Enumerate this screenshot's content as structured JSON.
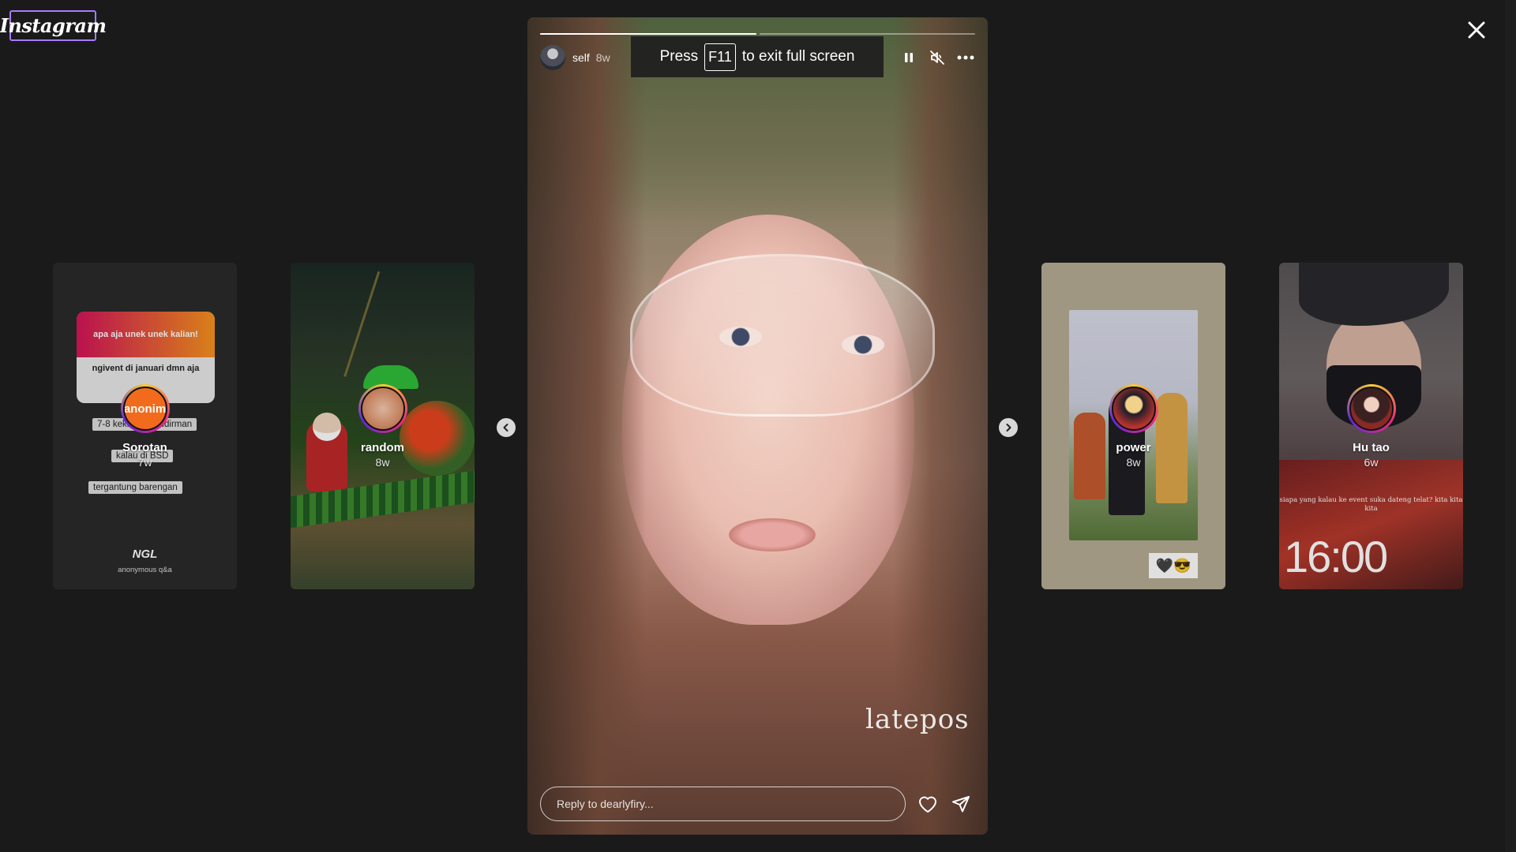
{
  "app": {
    "logo": "Instagram"
  },
  "colors": {
    "background": "#1a1a1a",
    "logo_border": "#a77bff",
    "ring_gradient": [
      "#f9ce34",
      "#ee2a7b",
      "#6228d7"
    ]
  },
  "icons": {
    "close": "close-icon",
    "prev": "chevron-left-icon",
    "next": "chevron-right-icon",
    "pause": "pause-icon",
    "mute": "speaker-muted-icon",
    "more": "more-horizontal-icon",
    "like": "heart-icon",
    "share": "send-icon"
  },
  "stories_left": [
    {
      "username": "Sorotan",
      "time": "7w",
      "avatar_text": "anonim",
      "content": {
        "ngl_header": "apa aja unek unek kalian!",
        "ngl_question": "ngivent di januari dmn aja",
        "chips": [
          "7-8 kekrejang sudirman",
          "kalau di BSD",
          "tergantung barengan"
        ],
        "brand": "NGL",
        "brand_sub": "anonymous q&a"
      }
    },
    {
      "username": "random",
      "time": "8w"
    }
  ],
  "current_story": {
    "username": "self",
    "time": "8w",
    "progress": [
      1.0,
      0.0
    ],
    "watermark": "latepos",
    "reply_placeholder": "Reply to dearlyfiry..."
  },
  "fullscreen_toast": {
    "press": "Press",
    "key": "F11",
    "rest": "to exit full screen"
  },
  "stories_right": [
    {
      "username": "power",
      "time": "8w",
      "sticker": "🖤😎"
    },
    {
      "username": "Hu tao",
      "time": "6w",
      "caption": "siapa yang kalau ke event suka dateng telat? kita kita kita",
      "clock": "16:00"
    }
  ]
}
